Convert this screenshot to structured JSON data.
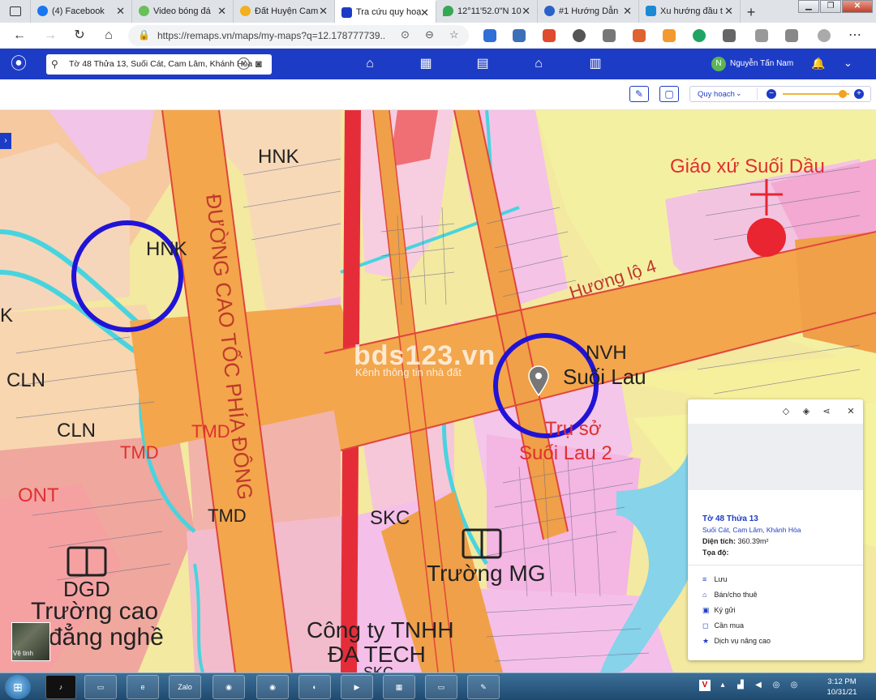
{
  "browser": {
    "tabs": [
      {
        "label": "(4) Facebook",
        "fav_color": "#1877f2"
      },
      {
        "label": "Video bóng đá",
        "fav_color": "#6bbf59"
      },
      {
        "label": "Đất Huyện Cam",
        "fav_color": "#f2b01e"
      },
      {
        "label": "Tra cứu quy hoạ",
        "fav_color": "#1d3cc6"
      },
      {
        "label": "12°11'52.0\"N 10",
        "fav_color": "#34a853"
      },
      {
        "label": "#1 Hướng Dẫn",
        "fav_color": "#2a62c9"
      },
      {
        "label": "Xu hướng đầu t",
        "fav_color": "#1a8ad4"
      }
    ],
    "active_tab": 3,
    "new_tab": "+",
    "url": "https://remaps.vn/maps/my-maps?q=12.178777739..."
  },
  "app": {
    "search_value": "Tờ 48 Thửa 13, Suối Cát, Cam Lâm, Khánh Hòa",
    "user_initial": "N",
    "user_name": "Nguyễn Tấn Nam",
    "layer_label": "Quy hoạch",
    "zoom_level_fraction": 0.9,
    "brand_color": "#1d3cc6"
  },
  "map_labels": {
    "hnk_1": "HNK",
    "hnk_2": "HNK",
    "k": "K",
    "cln_1": "CLN",
    "cln_2": "CLN",
    "tmd_1": "TMD",
    "tmd_2": "TMD",
    "tmd_3": "TMD",
    "ont": "ONT",
    "dgd": "DGD",
    "truong_cao": "Trường cao",
    "dang_nghe": "đẳng nghề",
    "skc": "SKC",
    "truong_mg": "Trường MG",
    "cong_ty": "Công ty TNHH",
    "da_tech": "ĐA TECH",
    "skc_2": "SKC",
    "road_1": "ĐƯỜNG CAO TỐC PHÍA ĐÔNG",
    "road_2": "Hương lộ 4",
    "giao_xu": "Giáo xứ Suối Dầu",
    "nvh": "NVH",
    "suoi_lau": "Suối Lau",
    "tru_so": "Trụ sở",
    "suoi_lau_2": "Suối Lau 2",
    "watermark": "bds123.vn",
    "watermark_sub": "Kênh thông tin nhà đất",
    "satellite": "Vệ tinh"
  },
  "info_card": {
    "title": "Tờ 48 Thửa 13",
    "address": "Suối Cát, Cam Lâm, Khánh Hòa",
    "area_label": "Diện tích:",
    "area_value": "360.39m²",
    "coord_label": "Tọa độ:",
    "actions": [
      "Lưu",
      "Bán/cho thuê",
      "Ký gửi",
      "Cần mua",
      "Dịch vụ nâng cao"
    ]
  },
  "taskbar": {
    "apps": [
      "TikTok",
      "Explorer",
      "Edge",
      "Zalo",
      "Chrome-H",
      "Chrome",
      "CC",
      "Media",
      "Calc",
      "Window",
      "Paint"
    ],
    "time": "3:12 PM",
    "date": "10/31/21"
  }
}
